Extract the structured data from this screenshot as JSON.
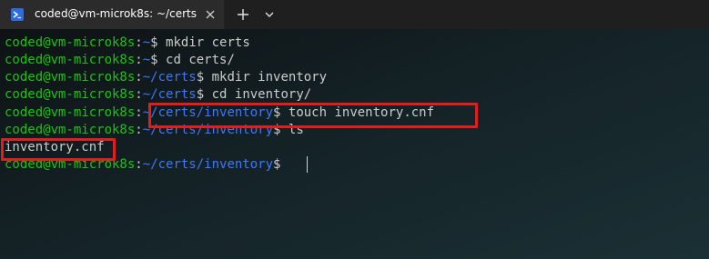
{
  "tab": {
    "title": "coded@vm-microk8s: ~/certs",
    "icon": "terminal-icon",
    "close_icon": "close-icon"
  },
  "titlebar": {
    "new_tab_icon": "plus-icon",
    "dropdown_icon": "chevron-down-icon"
  },
  "colors": {
    "user_host": "#16c60c",
    "path": "#3b78ff",
    "text": "#cccccc",
    "highlight": "#e01e1e"
  },
  "terminal": {
    "lines": [
      {
        "user": "coded@vm-microk8s",
        "sep": ":",
        "path": "~",
        "prompt": "$ ",
        "cmd": "mkdir certs"
      },
      {
        "user": "coded@vm-microk8s",
        "sep": ":",
        "path": "~",
        "prompt": "$ ",
        "cmd": "cd certs/"
      },
      {
        "user": "coded@vm-microk8s",
        "sep": ":",
        "path": "~/certs",
        "prompt": "$ ",
        "cmd": "mkdir inventory"
      },
      {
        "user": "coded@vm-microk8s",
        "sep": ":",
        "path": "~/certs",
        "prompt": "$ ",
        "cmd": "cd inventory/"
      },
      {
        "user": "coded@vm-microk8s",
        "sep": ":",
        "path": "~/certs/inventory",
        "prompt": "$ ",
        "cmd": "touch inventory.cnf"
      },
      {
        "user": "coded@vm-microk8s",
        "sep": ":",
        "path": "~/certs/inventory",
        "prompt": "$ ",
        "cmd": "ls"
      },
      {
        "output": "inventory.cnf"
      },
      {
        "user": "coded@vm-microk8s",
        "sep": ":",
        "path": "~/certs/inventory",
        "prompt": "$ ",
        "cmd": ""
      }
    ]
  }
}
